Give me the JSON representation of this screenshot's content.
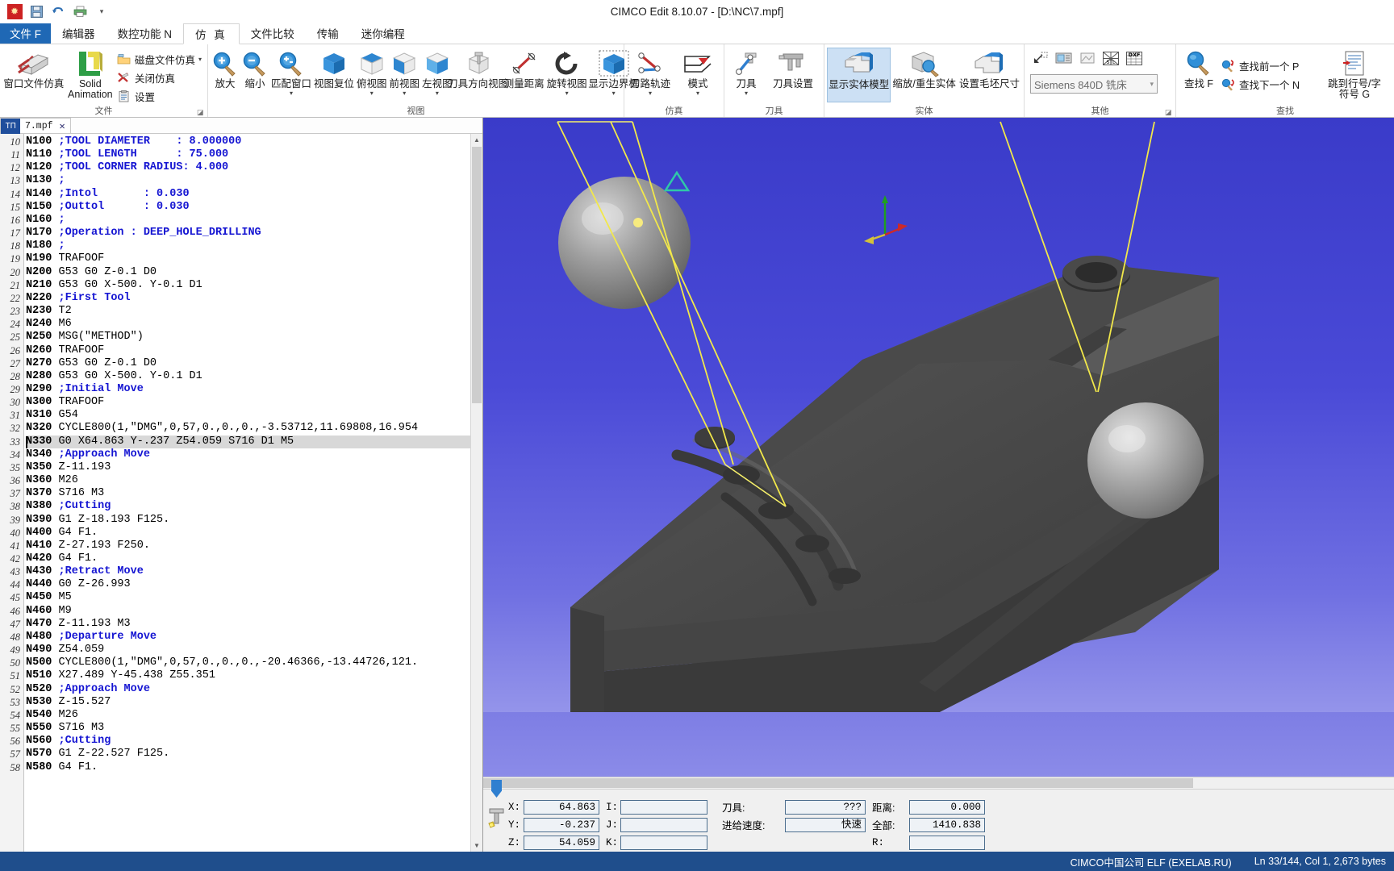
{
  "window": {
    "title": "CIMCO Edit 8.10.07 - [D:\\NC\\7.mpf]",
    "app_icon": "cimco-logo-icon"
  },
  "quick_access": [
    {
      "name": "save-icon",
      "glyph": "💾"
    },
    {
      "name": "undo-icon",
      "glyph": "↶"
    },
    {
      "name": "print-icon",
      "glyph": "🖨"
    },
    {
      "name": "customize-qat-icon",
      "glyph": "▾"
    }
  ],
  "ribbon_tabs": [
    {
      "label": "文件 F",
      "active": false,
      "file": true
    },
    {
      "label": "编辑器",
      "active": false
    },
    {
      "label": "数控功能 N",
      "active": false
    },
    {
      "label": "仿 真",
      "active": true
    },
    {
      "label": "文件比较",
      "active": false
    },
    {
      "label": "传输",
      "active": false
    },
    {
      "label": "迷你编程",
      "active": false
    }
  ],
  "ribbon": {
    "groups": [
      {
        "title": "文件",
        "big": [
          {
            "label": "窗口文件仿真",
            "icon": "window-file-sim-icon"
          },
          {
            "label": "Solid Animation",
            "icon": "solid-animation-icon"
          }
        ],
        "small": [
          {
            "label": "磁盘文件仿真",
            "icon": "disk-file-sim-icon",
            "caret": true
          },
          {
            "label": "关闭仿真",
            "icon": "close-sim-icon",
            "caret": false
          },
          {
            "label": "设置",
            "icon": "settings-icon",
            "caret": false
          }
        ],
        "dialog_launcher": true
      },
      {
        "title": "视图",
        "big": [
          {
            "label": "放大",
            "icon": "zoom-in-icon"
          },
          {
            "label": "缩小",
            "icon": "zoom-out-icon"
          },
          {
            "label": "匹配窗口",
            "icon": "fit-window-icon",
            "caret": true
          },
          {
            "label": "视图复位",
            "icon": "reset-view-icon"
          },
          {
            "label": "俯视图",
            "icon": "top-view-icon",
            "caret": true
          },
          {
            "label": "前视图",
            "icon": "front-view-icon",
            "caret": true
          },
          {
            "label": "左视图",
            "icon": "left-view-icon",
            "caret": true
          },
          {
            "label": "刀具方向视图",
            "icon": "tool-direction-view-icon"
          },
          {
            "label": "测量距离",
            "icon": "measure-distance-icon"
          },
          {
            "label": "旋转视图",
            "icon": "rotate-view-icon",
            "caret": true
          },
          {
            "label": "显示边界框",
            "icon": "show-bounding-box-icon",
            "caret": true
          }
        ]
      },
      {
        "title": "仿真",
        "big": [
          {
            "label": "刀路轨迹",
            "icon": "toolpath-icon",
            "caret": true
          },
          {
            "label": "模式",
            "icon": "mode-icon",
            "caret": true
          }
        ]
      },
      {
        "title": "刀具",
        "big": [
          {
            "label": "刀具",
            "icon": "tool-icon",
            "caret": true
          },
          {
            "label": "刀具设置",
            "icon": "tool-settings-icon"
          }
        ]
      },
      {
        "title": "实体",
        "big": [
          {
            "label": "显示实体模型",
            "icon": "show-solid-model-icon",
            "selected": true
          },
          {
            "label": "缩放/重生实体",
            "icon": "zoom-regen-solid-icon"
          },
          {
            "label": "设置毛坯尺寸",
            "icon": "set-stock-size-icon"
          }
        ]
      },
      {
        "title": "其他",
        "mini": [
          {
            "name": "collapse-icon",
            "glyph": "↙"
          },
          {
            "name": "machine-icon",
            "glyph": "⌸"
          },
          {
            "name": "window-icon",
            "glyph": "▢"
          },
          {
            "name": "stl-export-icon",
            "glyph": "STL"
          },
          {
            "name": "dxf-export-icon",
            "glyph": "DXF"
          }
        ],
        "combo_value": "Siemens 840D 铣床",
        "dialog_launcher": true
      },
      {
        "title": "查找",
        "big": [
          {
            "label": "查找 F",
            "icon": "search-icon"
          }
        ],
        "small": [
          {
            "label": "查找前一个 P",
            "icon": "find-prev-icon"
          },
          {
            "label": "查找下一个 N",
            "icon": "find-next-icon"
          }
        ],
        "big_right": [
          {
            "label": "跳到行号/字符号 G",
            "icon": "goto-line-icon"
          }
        ]
      }
    ]
  },
  "document": {
    "tab_label": "7.mpf",
    "tab_icon": "nc-file-icon",
    "close_icon": "close-icon"
  },
  "code": {
    "first_line_number": 10,
    "highlight_line": 33,
    "lines": [
      {
        "n": 10,
        "segs": [
          {
            "t": "N100 ",
            "c": "n"
          },
          {
            "t": ";TOOL DIAMETER    : ",
            "c": "cmt"
          },
          {
            "t": "8.000000",
            "c": "cmt"
          }
        ]
      },
      {
        "n": 11,
        "segs": [
          {
            "t": "N110 ",
            "c": "n"
          },
          {
            "t": ";TOOL LENGTH      : ",
            "c": "cmt"
          },
          {
            "t": "75.000",
            "c": "cmt"
          }
        ]
      },
      {
        "n": 12,
        "segs": [
          {
            "t": "N120 ",
            "c": "n"
          },
          {
            "t": ";TOOL CORNER RADIUS: ",
            "c": "cmt"
          },
          {
            "t": "4.000",
            "c": "cmt"
          }
        ]
      },
      {
        "n": 13,
        "segs": [
          {
            "t": "N130 ",
            "c": "n"
          },
          {
            "t": ";",
            "c": "cmt"
          }
        ]
      },
      {
        "n": 14,
        "segs": [
          {
            "t": "N140 ",
            "c": "n"
          },
          {
            "t": ";Intol       : ",
            "c": "cmt"
          },
          {
            "t": "0.030",
            "c": "cmt"
          }
        ]
      },
      {
        "n": 15,
        "segs": [
          {
            "t": "N150 ",
            "c": "n"
          },
          {
            "t": ";Outtol      : ",
            "c": "cmt"
          },
          {
            "t": "0.030",
            "c": "cmt"
          }
        ]
      },
      {
        "n": 16,
        "segs": [
          {
            "t": "N160 ",
            "c": "n"
          },
          {
            "t": ";",
            "c": "cmt"
          }
        ]
      },
      {
        "n": 17,
        "segs": [
          {
            "t": "N170 ",
            "c": "n"
          },
          {
            "t": ";Operation : DEEP_HOLE_DRILLING",
            "c": "cmt"
          }
        ]
      },
      {
        "n": 18,
        "segs": [
          {
            "t": "N180 ",
            "c": "n"
          },
          {
            "t": ";",
            "c": "cmt"
          }
        ]
      },
      {
        "n": 19,
        "segs": [
          {
            "t": "N190 ",
            "c": "n"
          },
          {
            "t": "TRAFOOF",
            "c": "txt"
          }
        ]
      },
      {
        "n": 20,
        "segs": [
          {
            "t": "N200 ",
            "c": "n"
          },
          {
            "t": "G53 G0 Z-0.1 D0",
            "c": "txt"
          }
        ]
      },
      {
        "n": 21,
        "segs": [
          {
            "t": "N210 ",
            "c": "n"
          },
          {
            "t": "G53 G0 X-500. Y-0.1 D1",
            "c": "txt"
          }
        ]
      },
      {
        "n": 22,
        "segs": [
          {
            "t": "N220 ",
            "c": "n"
          },
          {
            "t": ";First Tool",
            "c": "cmt"
          }
        ]
      },
      {
        "n": 23,
        "segs": [
          {
            "t": "N230 ",
            "c": "n"
          },
          {
            "t": "T2",
            "c": "txt"
          }
        ]
      },
      {
        "n": 24,
        "segs": [
          {
            "t": "N240 ",
            "c": "n"
          },
          {
            "t": "M6",
            "c": "txt"
          }
        ]
      },
      {
        "n": 25,
        "segs": [
          {
            "t": "N250 ",
            "c": "n"
          },
          {
            "t": "MSG(\"METHOD\")",
            "c": "txt"
          }
        ]
      },
      {
        "n": 26,
        "segs": [
          {
            "t": "N260 ",
            "c": "n"
          },
          {
            "t": "TRAFOOF",
            "c": "txt"
          }
        ]
      },
      {
        "n": 27,
        "segs": [
          {
            "t": "N270 ",
            "c": "n"
          },
          {
            "t": "G53 G0 Z-0.1 D0",
            "c": "txt"
          }
        ]
      },
      {
        "n": 28,
        "segs": [
          {
            "t": "N280 ",
            "c": "n"
          },
          {
            "t": "G53 G0 X-500. Y-0.1 D1",
            "c": "txt"
          }
        ]
      },
      {
        "n": 29,
        "segs": [
          {
            "t": "N290 ",
            "c": "n"
          },
          {
            "t": ";Initial Move",
            "c": "cmt"
          }
        ]
      },
      {
        "n": 30,
        "segs": [
          {
            "t": "N300 ",
            "c": "n"
          },
          {
            "t": "TRAFOOF",
            "c": "txt"
          }
        ]
      },
      {
        "n": 31,
        "segs": [
          {
            "t": "N310 ",
            "c": "n"
          },
          {
            "t": "G54",
            "c": "txt"
          }
        ]
      },
      {
        "n": 32,
        "segs": [
          {
            "t": "N320 ",
            "c": "n"
          },
          {
            "t": "CYCLE800(1,\"DMG\",0,57,0.,0.,0.,-3.53712,11.69808,16.954",
            "c": "txt"
          }
        ]
      },
      {
        "n": 33,
        "segs": [
          {
            "t": "N330 ",
            "c": "n"
          },
          {
            "t": "G0 X64.863 Y-.237 Z54.059 S716 D1 M5",
            "c": "txt"
          }
        ]
      },
      {
        "n": 34,
        "segs": [
          {
            "t": "N340 ",
            "c": "n"
          },
          {
            "t": ";Approach Move",
            "c": "cmt"
          }
        ]
      },
      {
        "n": 35,
        "segs": [
          {
            "t": "N350 ",
            "c": "n"
          },
          {
            "t": "Z-11.193",
            "c": "txt"
          }
        ]
      },
      {
        "n": 36,
        "segs": [
          {
            "t": "N360 ",
            "c": "n"
          },
          {
            "t": "M26",
            "c": "txt"
          }
        ]
      },
      {
        "n": 37,
        "segs": [
          {
            "t": "N370 ",
            "c": "n"
          },
          {
            "t": "S716 M3",
            "c": "txt"
          }
        ]
      },
      {
        "n": 38,
        "segs": [
          {
            "t": "N380 ",
            "c": "n"
          },
          {
            "t": ";Cutting",
            "c": "cmt"
          }
        ]
      },
      {
        "n": 39,
        "segs": [
          {
            "t": "N390 ",
            "c": "n"
          },
          {
            "t": "G1 Z-18.193 F125.",
            "c": "txt"
          }
        ]
      },
      {
        "n": 40,
        "segs": [
          {
            "t": "N400 ",
            "c": "n"
          },
          {
            "t": "G4 F1.",
            "c": "txt"
          }
        ]
      },
      {
        "n": 41,
        "segs": [
          {
            "t": "N410 ",
            "c": "n"
          },
          {
            "t": "Z-27.193 F250.",
            "c": "txt"
          }
        ]
      },
      {
        "n": 42,
        "segs": [
          {
            "t": "N420 ",
            "c": "n"
          },
          {
            "t": "G4 F1.",
            "c": "txt"
          }
        ]
      },
      {
        "n": 43,
        "segs": [
          {
            "t": "N430 ",
            "c": "n"
          },
          {
            "t": ";Retract Move",
            "c": "cmt"
          }
        ]
      },
      {
        "n": 44,
        "segs": [
          {
            "t": "N440 ",
            "c": "n"
          },
          {
            "t": "G0 Z-26.993",
            "c": "txt"
          }
        ]
      },
      {
        "n": 45,
        "segs": [
          {
            "t": "N450 ",
            "c": "n"
          },
          {
            "t": "M5",
            "c": "txt"
          }
        ]
      },
      {
        "n": 46,
        "segs": [
          {
            "t": "N460 ",
            "c": "n"
          },
          {
            "t": "M9",
            "c": "txt"
          }
        ]
      },
      {
        "n": 47,
        "segs": [
          {
            "t": "N470 ",
            "c": "n"
          },
          {
            "t": "Z-11.193 M3",
            "c": "txt"
          }
        ]
      },
      {
        "n": 48,
        "segs": [
          {
            "t": "N480 ",
            "c": "n"
          },
          {
            "t": ";Departure Move",
            "c": "cmt"
          }
        ]
      },
      {
        "n": 49,
        "segs": [
          {
            "t": "N490 ",
            "c": "n"
          },
          {
            "t": "Z54.059",
            "c": "txt"
          }
        ]
      },
      {
        "n": 50,
        "segs": [
          {
            "t": "N500 ",
            "c": "n"
          },
          {
            "t": "CYCLE800(1,\"DMG\",0,57,0.,0.,0.,-20.46366,-13.44726,121.",
            "c": "txt"
          }
        ]
      },
      {
        "n": 51,
        "segs": [
          {
            "t": "N510 ",
            "c": "n"
          },
          {
            "t": "X27.489 Y-45.438 Z55.351",
            "c": "txt"
          }
        ]
      },
      {
        "n": 52,
        "segs": [
          {
            "t": "N520 ",
            "c": "n"
          },
          {
            "t": ";Approach Move",
            "c": "cmt"
          }
        ]
      },
      {
        "n": 53,
        "segs": [
          {
            "t": "N530 ",
            "c": "n"
          },
          {
            "t": "Z-15.527",
            "c": "txt"
          }
        ]
      },
      {
        "n": 54,
        "segs": [
          {
            "t": "N540 ",
            "c": "n"
          },
          {
            "t": "M26",
            "c": "txt"
          }
        ]
      },
      {
        "n": 55,
        "segs": [
          {
            "t": "N550 ",
            "c": "n"
          },
          {
            "t": "S716 M3",
            "c": "txt"
          }
        ]
      },
      {
        "n": 56,
        "segs": [
          {
            "t": "N560 ",
            "c": "n"
          },
          {
            "t": ";Cutting",
            "c": "cmt"
          }
        ]
      },
      {
        "n": 57,
        "segs": [
          {
            "t": "N570 ",
            "c": "n"
          },
          {
            "t": "G1 Z-22.527 F125.",
            "c": "txt"
          }
        ]
      },
      {
        "n": 58,
        "segs": [
          {
            "t": "N580 ",
            "c": "n"
          },
          {
            "t": "G4 F1.",
            "c": "txt"
          }
        ]
      }
    ]
  },
  "coord_panel": {
    "x_label": "X:",
    "x_value": "64.863",
    "y_label": "Y:",
    "y_value": "-0.237",
    "z_label": "Z:",
    "z_value": "54.059",
    "i_label": "I:",
    "i_value": "",
    "j_label": "J:",
    "j_value": "",
    "k_label": "K:",
    "k_value": "",
    "tool_label": "刀具:",
    "tool_value": "???",
    "feed_label": "进给速度:",
    "feed_value": "快速",
    "dist_label": "距离:",
    "dist_value": "0.000",
    "total_label": "全部:",
    "total_value": "1410.838",
    "r_label": "R:",
    "r_value": ""
  },
  "statusbar": {
    "left": "",
    "company": "CIMCO中国公司 ELF (EXELAB.RU)",
    "position": "Ln 33/144, Col 1, 2,673 bytes"
  }
}
